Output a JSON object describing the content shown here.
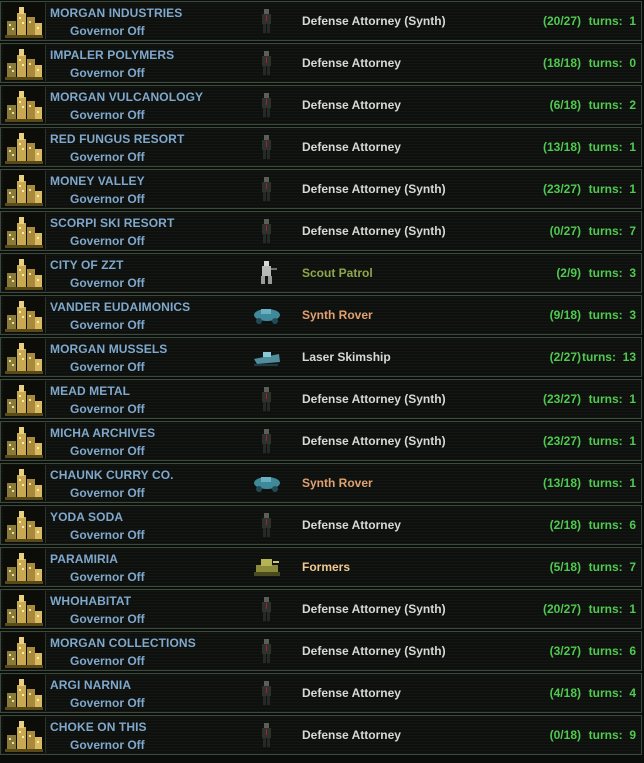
{
  "colors": {
    "city_name": "#7fa8cc",
    "progress": "#4fc94f",
    "production_default": "#d8d8d8",
    "production_scout": "#8fa84a",
    "production_synth_rover": "#e0a070",
    "production_formers": "#f0c890",
    "row_border": "#3c4a3c"
  },
  "rows": [
    {
      "name": "MORGAN INDUSTRIES",
      "governor": "Governor Off",
      "icon": "attorney-icon",
      "production": "Defense Attorney (Synth)",
      "style": "c-unit",
      "progress": "(20/27)",
      "turns": "turns:  1"
    },
    {
      "name": "IMPALER POLYMERS",
      "governor": "Governor Off",
      "icon": "attorney-icon",
      "production": "Defense Attorney",
      "style": "c-unit",
      "progress": "(18/18)",
      "turns": "turns:  0"
    },
    {
      "name": "MORGAN VULCANOLOGY",
      "governor": "Governor Off",
      "icon": "attorney-icon",
      "production": "Defense Attorney",
      "style": "c-unit",
      "progress": "(6/18)",
      "turns": "turns:  2"
    },
    {
      "name": "RED FUNGUS RESORT",
      "governor": "Governor Off",
      "icon": "attorney-icon",
      "production": "Defense Attorney",
      "style": "c-unit",
      "progress": "(13/18)",
      "turns": "turns:  1"
    },
    {
      "name": "MONEY VALLEY",
      "governor": "Governor Off",
      "icon": "attorney-icon",
      "production": "Defense Attorney (Synth)",
      "style": "c-unit",
      "progress": "(23/27)",
      "turns": "turns:  1"
    },
    {
      "name": "SCORPI SKI RESORT",
      "governor": "Governor Off",
      "icon": "attorney-icon",
      "production": "Defense Attorney (Synth)",
      "style": "c-unit",
      "progress": "(0/27)",
      "turns": "turns:  7"
    },
    {
      "name": "CITY OF ZZT",
      "governor": "Governor Off",
      "icon": "scout-icon",
      "production": "Scout Patrol",
      "style": "c-scout",
      "progress": "(2/9)",
      "turns": "turns:  3"
    },
    {
      "name": "VANDER EUDAIMONICS",
      "governor": "Governor Off",
      "icon": "rover-icon",
      "production": "Synth Rover",
      "style": "c-synth",
      "progress": "(9/18)",
      "turns": "turns:  3"
    },
    {
      "name": "MORGAN MUSSELS",
      "governor": "Governor Off",
      "icon": "skimship-icon",
      "production": "Laser Skimship",
      "style": "c-unit",
      "progress": "(2/27)",
      "turns": "turns:  13"
    },
    {
      "name": "MEAD METAL",
      "governor": "Governor Off",
      "icon": "attorney-icon",
      "production": "Defense Attorney (Synth)",
      "style": "c-unit",
      "progress": "(23/27)",
      "turns": "turns:  1"
    },
    {
      "name": "MICHA ARCHIVES",
      "governor": "Governor Off",
      "icon": "attorney-icon",
      "production": "Defense Attorney (Synth)",
      "style": "c-unit",
      "progress": "(23/27)",
      "turns": "turns:  1"
    },
    {
      "name": "CHAUNK CURRY CO.",
      "governor": "Governor Off",
      "icon": "rover-icon",
      "production": "Synth Rover",
      "style": "c-synth",
      "progress": "(13/18)",
      "turns": "turns:  1"
    },
    {
      "name": "YODA SODA",
      "governor": "Governor Off",
      "icon": "attorney-icon",
      "production": "Defense Attorney",
      "style": "c-unit",
      "progress": "(2/18)",
      "turns": "turns:  6"
    },
    {
      "name": "PARAMIRIA",
      "governor": "Governor Off",
      "icon": "formers-icon",
      "production": "Formers",
      "style": "c-formers",
      "progress": "(5/18)",
      "turns": "turns:  7"
    },
    {
      "name": "WHOHABITAT",
      "governor": "Governor Off",
      "icon": "attorney-icon",
      "production": "Defense Attorney (Synth)",
      "style": "c-unit",
      "progress": "(20/27)",
      "turns": "turns:  1"
    },
    {
      "name": "MORGAN COLLECTIONS",
      "governor": "Governor Off",
      "icon": "attorney-icon",
      "production": "Defense Attorney (Synth)",
      "style": "c-unit",
      "progress": "(3/27)",
      "turns": "turns:  6"
    },
    {
      "name": "ARGI NARNIA",
      "governor": "Governor Off",
      "icon": "attorney-icon",
      "production": "Defense Attorney",
      "style": "c-unit",
      "progress": "(4/18)",
      "turns": "turns:  4"
    },
    {
      "name": "CHOKE ON THIS",
      "governor": "Governor Off",
      "icon": "attorney-icon",
      "production": "Defense Attorney",
      "style": "c-unit",
      "progress": "(0/18)",
      "turns": "turns:  9"
    }
  ]
}
